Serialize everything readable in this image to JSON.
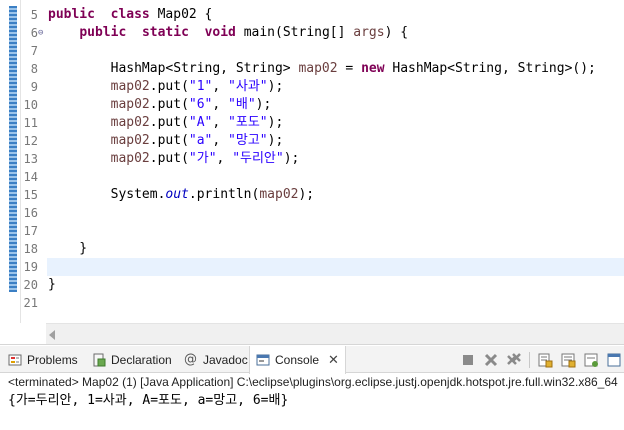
{
  "editor": {
    "lines": [
      {
        "n": "5",
        "fold": "",
        "tokens": [
          [
            "kw",
            "public"
          ],
          [
            "",
            "  "
          ],
          [
            "kw",
            "class"
          ],
          [
            "",
            "  Map02 {"
          ]
        ]
      },
      {
        "n": "6",
        "fold": "⊖",
        "tokens": [
          [
            "",
            "    "
          ],
          [
            "kw",
            "public"
          ],
          [
            "",
            "  "
          ],
          [
            "kw",
            "static"
          ],
          [
            "",
            "  "
          ],
          [
            "kw",
            "void"
          ],
          [
            "",
            "  main(String[] "
          ],
          [
            "var",
            "args"
          ],
          [
            "",
            ") {"
          ]
        ]
      },
      {
        "n": "7",
        "fold": "",
        "tokens": []
      },
      {
        "n": "8",
        "fold": "",
        "tokens": [
          [
            "",
            "        HashMap<String, String> "
          ],
          [
            "var",
            "map02"
          ],
          [
            "",
            "",
            " = "
          ],
          [
            "kw",
            "new"
          ],
          [
            "",
            "",
            " HashMap<String, String>();"
          ]
        ]
      },
      {
        "n": "9",
        "fold": "",
        "tokens": [
          [
            "",
            "        "
          ],
          [
            "var",
            "map02"
          ],
          [
            "",
            ".put("
          ],
          [
            "str",
            "\"1\""
          ],
          [
            "",
            ", "
          ],
          [
            "str",
            "\"사과\""
          ],
          [
            "",
            ");"
          ]
        ]
      },
      {
        "n": "10",
        "fold": "",
        "tokens": [
          [
            "",
            "        "
          ],
          [
            "var",
            "map02"
          ],
          [
            "",
            ".put("
          ],
          [
            "str",
            "\"6\""
          ],
          [
            "",
            ", "
          ],
          [
            "str",
            "\"배\""
          ],
          [
            "",
            ");"
          ]
        ]
      },
      {
        "n": "11",
        "fold": "",
        "tokens": [
          [
            "",
            "        "
          ],
          [
            "var",
            "map02"
          ],
          [
            "",
            ".put("
          ],
          [
            "str",
            "\"A\""
          ],
          [
            "",
            ", "
          ],
          [
            "str",
            "\"포도\""
          ],
          [
            "",
            ");"
          ]
        ]
      },
      {
        "n": "12",
        "fold": "",
        "tokens": [
          [
            "",
            "        "
          ],
          [
            "var",
            "map02"
          ],
          [
            "",
            ".put("
          ],
          [
            "str",
            "\"a\""
          ],
          [
            "",
            ", "
          ],
          [
            "str",
            "\"망고\""
          ],
          [
            "",
            ");"
          ]
        ]
      },
      {
        "n": "13",
        "fold": "",
        "tokens": [
          [
            "",
            "        "
          ],
          [
            "var",
            "map02"
          ],
          [
            "",
            ".put("
          ],
          [
            "str",
            "\"가\""
          ],
          [
            "",
            ", "
          ],
          [
            "str",
            "\"두리안\""
          ],
          [
            "",
            ");"
          ]
        ]
      },
      {
        "n": "14",
        "fold": "",
        "tokens": []
      },
      {
        "n": "15",
        "fold": "",
        "tokens": [
          [
            "",
            "        System."
          ],
          [
            "st",
            "out"
          ],
          [
            "",
            ".println("
          ],
          [
            "var",
            "map02"
          ],
          [
            "",
            ");"
          ]
        ]
      },
      {
        "n": "16",
        "fold": "",
        "tokens": []
      },
      {
        "n": "17",
        "fold": "",
        "tokens": []
      },
      {
        "n": "18",
        "fold": "",
        "tokens": [
          [
            "",
            "    }"
          ]
        ]
      },
      {
        "n": "19",
        "fold": "",
        "tokens": []
      },
      {
        "n": "20",
        "fold": "",
        "tokens": [
          [
            "",
            "}"
          ]
        ]
      },
      {
        "n": "21",
        "fold": "",
        "tokens": []
      }
    ],
    "current_line": "19"
  },
  "tabs": [
    {
      "label": "Problems",
      "icon": "problems-icon",
      "active": false
    },
    {
      "label": "Declaration",
      "icon": "declaration-icon",
      "active": false
    },
    {
      "label": "Javadoc",
      "icon": "javadoc-icon",
      "active": false
    },
    {
      "label": "Console",
      "icon": "console-icon",
      "active": true
    }
  ],
  "toolbar_icons": [
    "terminate-icon",
    "remove-launch-icon",
    "remove-all-terminated-icon",
    "scroll-lock-icon",
    "word-wrap-icon",
    "pin-console-icon",
    "display-selected-console-icon"
  ],
  "console": {
    "header": "<terminated> Map02 (1) [Java Application] C:\\eclipse\\plugins\\org.eclipse.justj.openjdk.hotspot.jre.full.win32.x86_64",
    "output": "{가=두리안, 1=사과, A=포도, a=망고, 6=배}"
  },
  "colors": {
    "keyword": "#7f0055",
    "string": "#2a00ff",
    "variable": "#6a3e3e",
    "static_field": "#0000c0",
    "current_line": "#e8f2fe"
  }
}
